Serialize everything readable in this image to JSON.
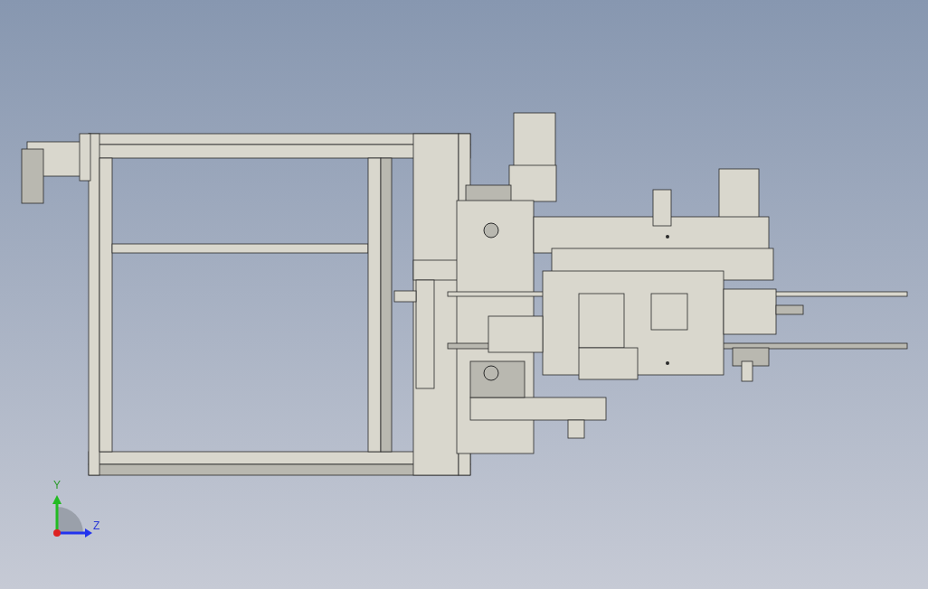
{
  "triad": {
    "axes": [
      {
        "kind": "y",
        "label": "Y"
      },
      {
        "kind": "z",
        "label": "Z"
      }
    ]
  }
}
